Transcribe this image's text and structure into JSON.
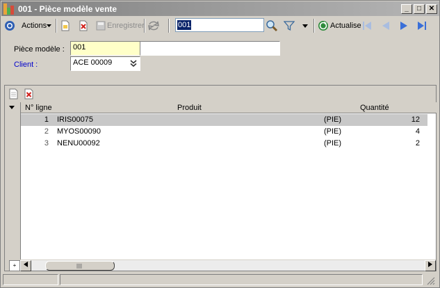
{
  "window": {
    "title": "001 -  Pièce modèle vente",
    "minimize": "_",
    "maximize": "□",
    "close": "✕"
  },
  "toolbar": {
    "actions_label": "Actions",
    "save_label": "Enregistrer",
    "search_value": "001",
    "refresh_label": "Actualise"
  },
  "form": {
    "piece_label": "Pièce modèle :",
    "piece_value": "001",
    "client_label": "Client :",
    "client_value": "ACE 00009"
  },
  "grid": {
    "columns": [
      "N° ligne",
      "Produit",
      "Quantité"
    ],
    "rows": [
      {
        "line": "1",
        "code": "IRIS00075",
        "unit": "(PIE)",
        "qty": "12"
      },
      {
        "line": "2",
        "code": "MYOS00090",
        "unit": "(PIE)",
        "qty": "4"
      },
      {
        "line": "3",
        "code": "NENU00092",
        "unit": "(PIE)",
        "qty": "2"
      }
    ],
    "add_symbol": "+"
  },
  "colors": {
    "accent": "#0a246a",
    "field_highlight": "#ffffc8",
    "link_blue": "#0000cc",
    "nav_blue": "#3a6fd8"
  }
}
